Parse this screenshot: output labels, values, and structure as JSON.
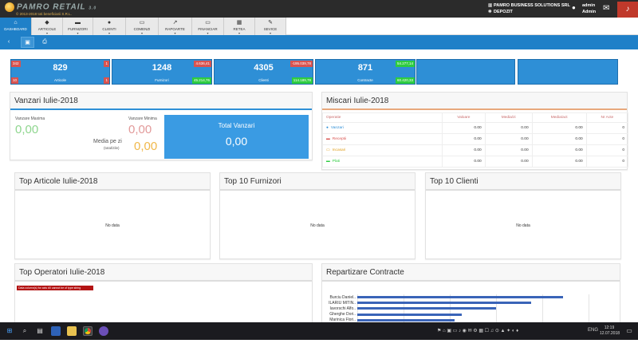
{
  "app": {
    "name": "PAMRO RETAIL",
    "suffix": "3.0",
    "copyright": "© 2013-2018 toti beneficiarii S.R.L."
  },
  "company": {
    "name": "PAMRO BUSINESS SOLUTIONS SRL",
    "location": "DEPOZIT"
  },
  "user": {
    "name": "admin",
    "role": "Admin"
  },
  "nav": [
    {
      "label": "DASHBOARD",
      "icon": "home-icon",
      "glyph": "⌂"
    },
    {
      "label": "ARTICOLE",
      "icon": "tag-icon",
      "glyph": "◆"
    },
    {
      "label": "FURNIZORI",
      "icon": "truck-icon",
      "glyph": "▬"
    },
    {
      "label": "CLIENTI",
      "icon": "users-icon",
      "glyph": "●"
    },
    {
      "label": "COMENZI",
      "icon": "cart-icon",
      "glyph": "▭"
    },
    {
      "label": "RAPOARTE",
      "icon": "chart-icon",
      "glyph": "↗"
    },
    {
      "label": "FINANCIAR",
      "icon": "cart-icon",
      "glyph": "▭"
    },
    {
      "label": "RETEA",
      "icon": "network-icon",
      "glyph": "▦"
    },
    {
      "label": "SEVICE",
      "icon": "wrench-icon",
      "glyph": "✎"
    }
  ],
  "stats": [
    {
      "value": "829",
      "label": "Articole",
      "tl": "342",
      "tr": "1",
      "bl": "10",
      "br": "1"
    },
    {
      "value": "1248",
      "label": "Furnizori",
      "tr": "4.636,41",
      "br": "45.214,76"
    },
    {
      "value": "4305",
      "label": "Clienti",
      "tr": "-195.039,78",
      "br": "114.189,78"
    },
    {
      "value": "871",
      "label": "Contracte",
      "tr": "54.277,14",
      "br": "60.420,33"
    }
  ],
  "vanzari": {
    "title": "Vanzari Iulie-2018",
    "max_label": "Vanzare Maxima",
    "max_value": "0,00",
    "min_label": "Vanzare Minima",
    "min_value": "0,00",
    "media_label": "Media pe zi",
    "media_sub": "(total/zile)",
    "media_value": "0,00",
    "total_label": "Total Vanzari",
    "total_value": "0,00"
  },
  "miscari": {
    "title": "Miscari Iulie-2018",
    "columns": [
      "Operatie",
      "Valoare",
      "Media/zi",
      "Media/act",
      "Nr Acte"
    ],
    "rows": [
      {
        "name": "Vanzari",
        "icon": "users-icon",
        "glyph": "●",
        "color": "#2e8fd6",
        "vals": [
          "0.00",
          "0.00",
          "0.00",
          "0"
        ]
      },
      {
        "name": "Receptii",
        "icon": "truck-icon",
        "glyph": "▬",
        "color": "#d9534f",
        "vals": [
          "0.00",
          "0.00",
          "0.00",
          "0"
        ]
      },
      {
        "name": "Incasari",
        "icon": "money-icon",
        "glyph": "▭",
        "color": "#e0a020",
        "vals": [
          "0.00",
          "0.00",
          "0.00",
          "0"
        ]
      },
      {
        "name": "Plati",
        "icon": "card-icon",
        "glyph": "▬",
        "color": "#2ecc40",
        "vals": [
          "0.00",
          "0.00",
          "0.00",
          "0"
        ]
      }
    ]
  },
  "top_articole": {
    "title": "Top Articole Iulie-2018",
    "empty": "No data"
  },
  "top_furnizori": {
    "title": "Top 10 Furnizori",
    "empty": "No data"
  },
  "top_clienti": {
    "title": "Top 10 Clienti",
    "empty": "No data"
  },
  "top_operatori": {
    "title": "Top Operatori Iulie-2018",
    "error": "Data column(s) for axis #0 cannot be of type string"
  },
  "repartizare": {
    "title": "Repartizare Contracte"
  },
  "chart_data": {
    "type": "bar",
    "orientation": "horizontal",
    "categories": [
      "Burciu Daniel..",
      "ILARIU MITIN..",
      "Iavorschi Alfo..",
      "Gherghe Dori..",
      "Marinica Flori.."
    ],
    "values": [
      0.89,
      0.75,
      0.6,
      0.45,
      0.42
    ],
    "xlim": [
      0,
      1
    ],
    "grid": true
  },
  "taskbar": {
    "time": "12:19",
    "date": "12.07.2018",
    "lang": "ENG"
  }
}
